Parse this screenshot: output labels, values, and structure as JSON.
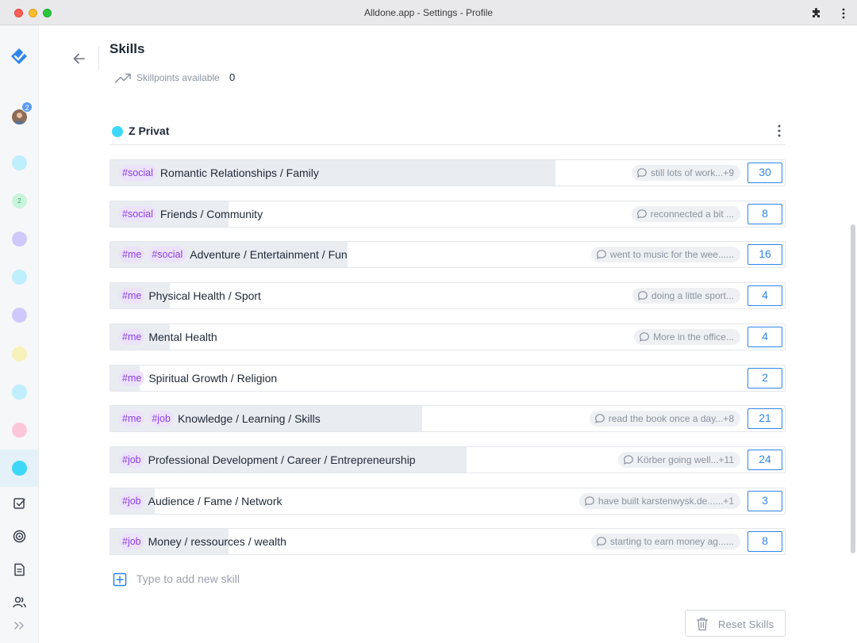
{
  "window": {
    "title": "Alldone.app - Settings - Profile"
  },
  "sidebar": {
    "avatar_badge": "2",
    "projects": [
      {
        "color": "#bfeefd",
        "label": ""
      },
      {
        "color": "#c9f5dd",
        "label": "2"
      },
      {
        "color": "#cfc9fb",
        "label": ""
      },
      {
        "color": "#bfeefd",
        "label": ""
      },
      {
        "color": "#cfc9fb",
        "label": ""
      },
      {
        "color": "#f7f1ba",
        "label": ""
      },
      {
        "color": "#bfeefd",
        "label": ""
      },
      {
        "color": "#fcc6d9",
        "label": ""
      },
      {
        "color": "#3dd7f7",
        "label": "",
        "active": true
      }
    ],
    "nav": [
      "tasks-icon",
      "goals-icon",
      "notes-icon",
      "contacts-icon"
    ]
  },
  "header": {
    "title": "Skills",
    "skillpoints_label": "Skillpoints available",
    "skillpoints_value": "0"
  },
  "project": {
    "name": "Z Privat",
    "color": "#3dd7f7"
  },
  "skills": [
    {
      "tags": [
        "#social"
      ],
      "name": "Romantic Relationships / Family",
      "comment": "still lots of work...+9",
      "points": "30",
      "progress": 0.66
    },
    {
      "tags": [
        "#social"
      ],
      "name": "Friends / Community",
      "comment": "reconnected a bit ...",
      "points": "8",
      "progress": 0.175
    },
    {
      "tags": [
        "#me",
        "#social"
      ],
      "name": "Adventure / Entertainment / Fun",
      "comment": "went to music for the wee......",
      "points": "16",
      "progress": 0.352
    },
    {
      "tags": [
        "#me"
      ],
      "name": "Physical Health / Sport",
      "comment": "doing a little sport...",
      "points": "4",
      "progress": 0.088
    },
    {
      "tags": [
        "#me"
      ],
      "name": "Mental Health",
      "comment": "More in the office...",
      "points": "4",
      "progress": 0.088
    },
    {
      "tags": [
        "#me"
      ],
      "name": "Spiritual Growth / Religion",
      "comment": "",
      "points": "2",
      "progress": 0.044
    },
    {
      "tags": [
        "#me",
        "#job"
      ],
      "name": "Knowledge / Learning / Skills",
      "comment": "read the book once a day...+8",
      "points": "21",
      "progress": 0.462
    },
    {
      "tags": [
        "#job"
      ],
      "name": "Professional Development / Career / Entrepreneurship",
      "comment": "Körber going well...+11",
      "points": "24",
      "progress": 0.528
    },
    {
      "tags": [
        "#job"
      ],
      "name": "Audience / Fame / Network",
      "comment": "have built karstenwysk.de......+1",
      "points": "3",
      "progress": 0.066
    },
    {
      "tags": [
        "#job"
      ],
      "name": "Money / ressources / wealth",
      "comment": "starting to earn money ag......",
      "points": "8",
      "progress": 0.175
    }
  ],
  "add_skill": {
    "placeholder": "Type to add new skill"
  },
  "reset": {
    "label": "Reset Skills"
  }
}
